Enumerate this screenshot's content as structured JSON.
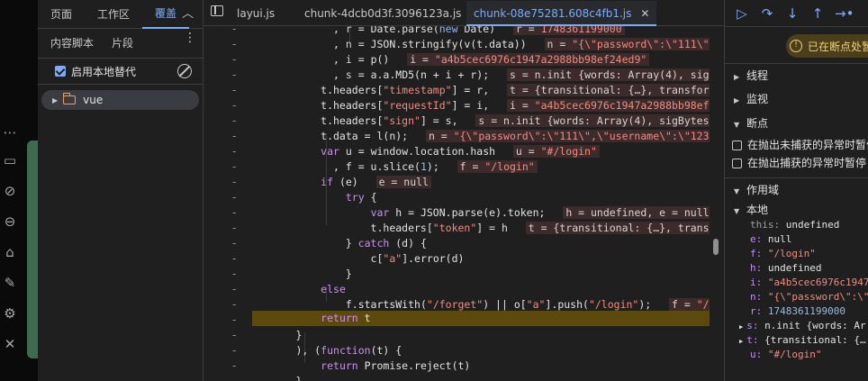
{
  "navigator": {
    "tabs": [
      "页面",
      "工作区",
      "覆盖"
    ],
    "active_tab": "覆盖",
    "subtabs": [
      "内容脚本",
      "片段"
    ],
    "override_label": "启用本地替代",
    "override_enabled": true,
    "folder_name": "vue"
  },
  "editor": {
    "file_tabs": [
      "layui.js",
      "chunk-4dcb0d3f.3096123a.js",
      "chunk-08e75281.608c4fb1.js"
    ],
    "active_file": "chunk-08e75281.608c4fb1.js",
    "gutter_marker": "-",
    "current_line_index": 19
  },
  "debugger": {
    "paused_label": "已在断点处暂停",
    "sections": {
      "threads": "线程",
      "watch": "监视",
      "breakpoints": "断点",
      "scope": "作用域",
      "local": "本地"
    },
    "breakpoint_options": [
      "在抛出未捕获的异常时暂停",
      "在抛出捕获的异常时暂停"
    ],
    "scope_vars": [
      {
        "key": "this",
        "value": "undefined",
        "type": "plain"
      },
      {
        "key": "e",
        "value": "null",
        "type": "plain"
      },
      {
        "key": "f",
        "value": "\"/login\"",
        "type": "str"
      },
      {
        "key": "h",
        "value": "undefined",
        "type": "plain"
      },
      {
        "key": "i",
        "value": "\"a4b5cec6976c1947",
        "type": "str"
      },
      {
        "key": "n",
        "value": "\"{\\\"password\\\":\\\"",
        "type": "str"
      },
      {
        "key": "r",
        "value": "1748361199000",
        "type": "num"
      },
      {
        "key": "s",
        "value": "n.init {words: Ar",
        "type": "plain",
        "expandable": true
      },
      {
        "key": "t",
        "value": "{transitional: {…",
        "type": "plain",
        "expandable": true
      },
      {
        "key": "u",
        "value": "\"#/login\"",
        "type": "str"
      }
    ]
  },
  "colors": {
    "accent": "#7cacf8",
    "paused_bg": "#4a3f1a",
    "current_line": "#5c4a0c",
    "string": "#f28b82",
    "keyword": "#c792ea"
  }
}
